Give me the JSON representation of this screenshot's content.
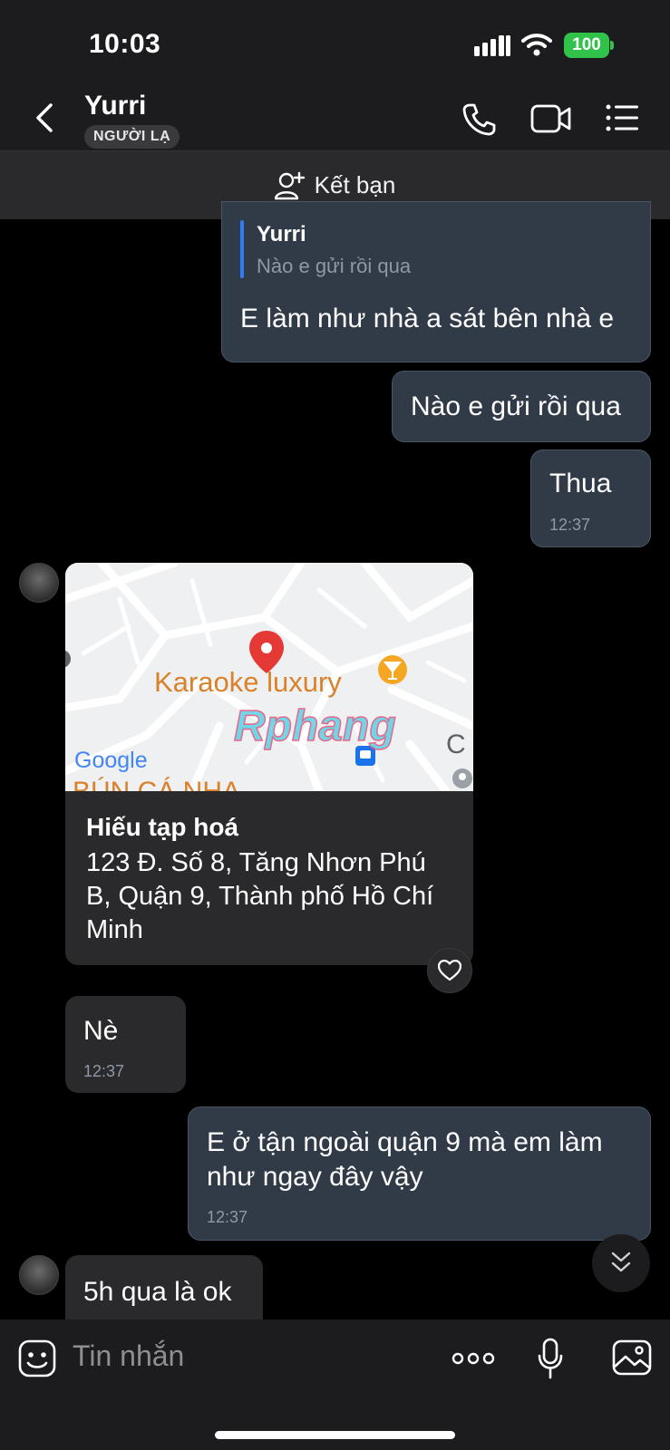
{
  "status_bar": {
    "time": "10:03",
    "battery": "100"
  },
  "header": {
    "contact_name": "Yurri",
    "badge": "NGƯỜI LẠ"
  },
  "add_friend": {
    "label": "Kết bạn"
  },
  "messages": {
    "m1": {
      "quote_author": "Yurri",
      "quote_text": "Nào e gửi rồi qua",
      "text": "E làm như nhà a sát bên nhà e"
    },
    "m2": {
      "text": "Nào e gửi rồi qua"
    },
    "m3": {
      "text": "Thua",
      "time": "12:37"
    },
    "map": {
      "map_label_poi": "Karaoke luxury",
      "map_label_google": "Google",
      "map_label_bottom": "BÚN CÁ NHA",
      "watermark": "Rphang",
      "place_title": "Hiếu tạp hoá",
      "place_address": "123 Đ. Số 8, Tăng Nhơn Phú B, Quận 9, Thành phố Hồ Chí Minh"
    },
    "m4": {
      "text": "Nè",
      "time": "12:37"
    },
    "m5": {
      "text": "E ở tận ngoài quận 9 mà em làm như ngay đây vậy",
      "time": "12:37"
    },
    "m6": {
      "text": "5h qua là ok"
    }
  },
  "input": {
    "placeholder": "Tin nhắn"
  },
  "icons": {
    "back": "chevron-left-icon",
    "call": "phone-icon",
    "video": "video-camera-icon",
    "menu": "list-icon",
    "add_friend": "add-user-icon",
    "sticker": "emoji-icon",
    "more": "more-dots-icon",
    "mic": "microphone-icon",
    "gallery": "image-icon",
    "scroll": "double-chevron-down-icon",
    "like": "heart-icon"
  },
  "colors": {
    "outgoing_bubble": "#313b48",
    "incoming_bubble": "#2a2a2c",
    "quote_bar": "#2f7cf6",
    "battery": "#30c24b",
    "pin": "#e53935"
  }
}
